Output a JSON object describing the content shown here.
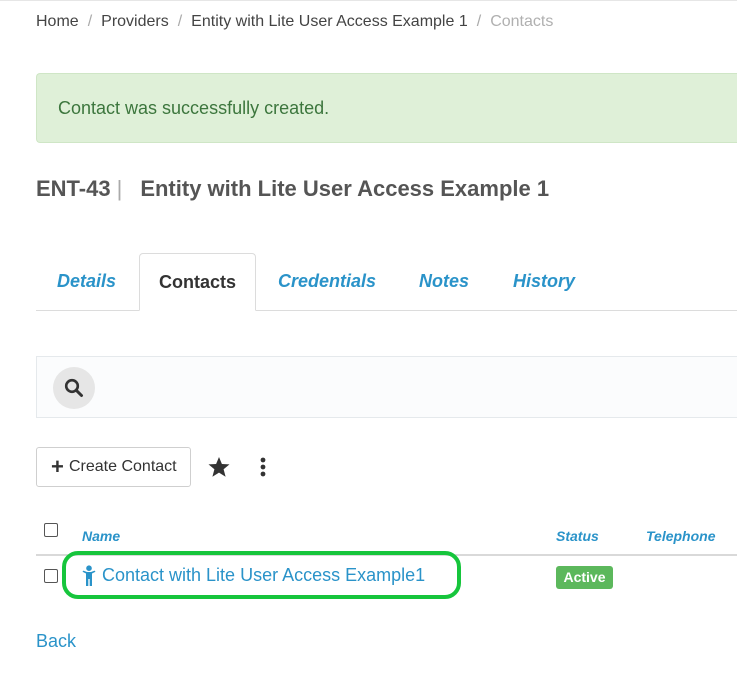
{
  "breadcrumb": {
    "items": [
      "Home",
      "Providers",
      "Entity with Lite User Access Example 1"
    ],
    "current": "Contacts",
    "separator": "/"
  },
  "alert": {
    "message": "Contact was successfully created."
  },
  "entity": {
    "id": "ENT-43",
    "separator": "|",
    "name": "Entity with Lite User Access Example 1"
  },
  "tabs": [
    {
      "label": "Details"
    },
    {
      "label": "Contacts",
      "active": true
    },
    {
      "label": "Credentials"
    },
    {
      "label": "Notes"
    },
    {
      "label": "History"
    }
  ],
  "toolbar": {
    "create_label": "Create Contact",
    "create_icon": "plus-icon",
    "favorite_icon": "star-icon",
    "more_icon": "kebab-menu-icon"
  },
  "search": {
    "icon": "search-icon"
  },
  "table": {
    "columns": [
      "Name",
      "Status",
      "Telephone"
    ],
    "rows": [
      {
        "name": "Contact with Lite User Access Example1",
        "icon": "person-icon",
        "status": "Active",
        "telephone": ""
      }
    ]
  },
  "back_label": "Back",
  "colors": {
    "link": "#2a93c9",
    "alert_bg": "#dff0d8",
    "alert_text": "#3c763d",
    "status_active": "#5cb85c",
    "highlight": "#16c53c"
  }
}
